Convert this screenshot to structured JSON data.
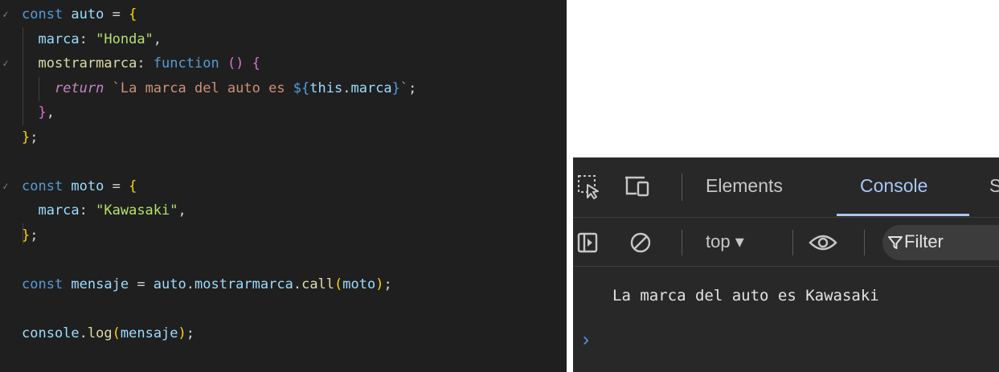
{
  "editor": {
    "lines": [
      {
        "fold": true,
        "segments": [
          [
            "kw",
            "const"
          ],
          [
            "var",
            " auto "
          ],
          [
            "punc",
            "= "
          ],
          [
            "b1",
            "{"
          ]
        ]
      },
      {
        "fold": false,
        "segments": [
          [
            "var",
            "  marca"
          ],
          [
            "punc",
            ": "
          ],
          [
            "green",
            "\"Honda\""
          ],
          [
            "punc",
            ","
          ]
        ]
      },
      {
        "fold": true,
        "segments": [
          [
            "var",
            "  "
          ],
          [
            "fn",
            "mostrarmarca"
          ],
          [
            "punc",
            ": "
          ],
          [
            "kw",
            "function"
          ],
          [
            "punc",
            " "
          ],
          [
            "b2",
            "()"
          ],
          [
            "punc",
            " "
          ],
          [
            "b2",
            "{"
          ]
        ]
      },
      {
        "fold": false,
        "segments": [
          [
            "var",
            "    "
          ],
          [
            "ctl",
            "return"
          ],
          [
            "punc",
            " "
          ],
          [
            "strlit",
            "`La marca del auto es "
          ],
          [
            "kw",
            "${"
          ],
          [
            "var",
            "this"
          ],
          [
            "punc",
            "."
          ],
          [
            "var",
            "marca"
          ],
          [
            "kw",
            "}"
          ],
          [
            "strlit",
            "`"
          ],
          [
            "punc",
            ";"
          ]
        ]
      },
      {
        "fold": false,
        "segments": [
          [
            "var",
            "  "
          ],
          [
            "b2",
            "}"
          ],
          [
            "punc",
            ","
          ]
        ]
      },
      {
        "fold": false,
        "segments": [
          [
            "b1",
            "}"
          ],
          [
            "punc",
            ";"
          ]
        ]
      },
      {
        "fold": false,
        "segments": []
      },
      {
        "fold": true,
        "segments": [
          [
            "kw",
            "const"
          ],
          [
            "var",
            " moto "
          ],
          [
            "punc",
            "= "
          ],
          [
            "b1",
            "{"
          ]
        ]
      },
      {
        "fold": false,
        "segments": [
          [
            "var",
            "  marca"
          ],
          [
            "punc",
            ": "
          ],
          [
            "green",
            "\"Kawasaki\""
          ],
          [
            "punc",
            ","
          ]
        ]
      },
      {
        "fold": false,
        "segments": [
          [
            "b1",
            "}"
          ],
          [
            "punc",
            ";"
          ]
        ]
      },
      {
        "fold": false,
        "segments": []
      },
      {
        "fold": false,
        "segments": [
          [
            "kw",
            "const"
          ],
          [
            "var",
            " mensaje "
          ],
          [
            "punc",
            "= "
          ],
          [
            "var",
            "auto"
          ],
          [
            "punc",
            "."
          ],
          [
            "var",
            "mostrarmarca"
          ],
          [
            "punc",
            "."
          ],
          [
            "fn",
            "call"
          ],
          [
            "b1",
            "("
          ],
          [
            "var",
            "moto"
          ],
          [
            "b1",
            ")"
          ],
          [
            "punc",
            ";"
          ]
        ]
      },
      {
        "fold": false,
        "segments": []
      },
      {
        "fold": false,
        "segments": [
          [
            "var",
            "console"
          ],
          [
            "punc",
            "."
          ],
          [
            "fn",
            "log"
          ],
          [
            "b1",
            "("
          ],
          [
            "var",
            "mensaje"
          ],
          [
            "b1",
            ")"
          ],
          [
            "punc",
            ";"
          ]
        ]
      }
    ]
  },
  "devtools": {
    "tabs": {
      "elements": "Elements",
      "console": "Console",
      "sources_partial": "S"
    },
    "toolbar": {
      "context": "top ▾",
      "filter": "Filter"
    },
    "console_output": "La marca del auto es Kawasaki",
    "prompt_symbol": "›",
    "colors": {
      "active_tab": "#a8c7fa",
      "panel_bg": "#282828",
      "editor_bg": "#1f1f1f"
    }
  }
}
